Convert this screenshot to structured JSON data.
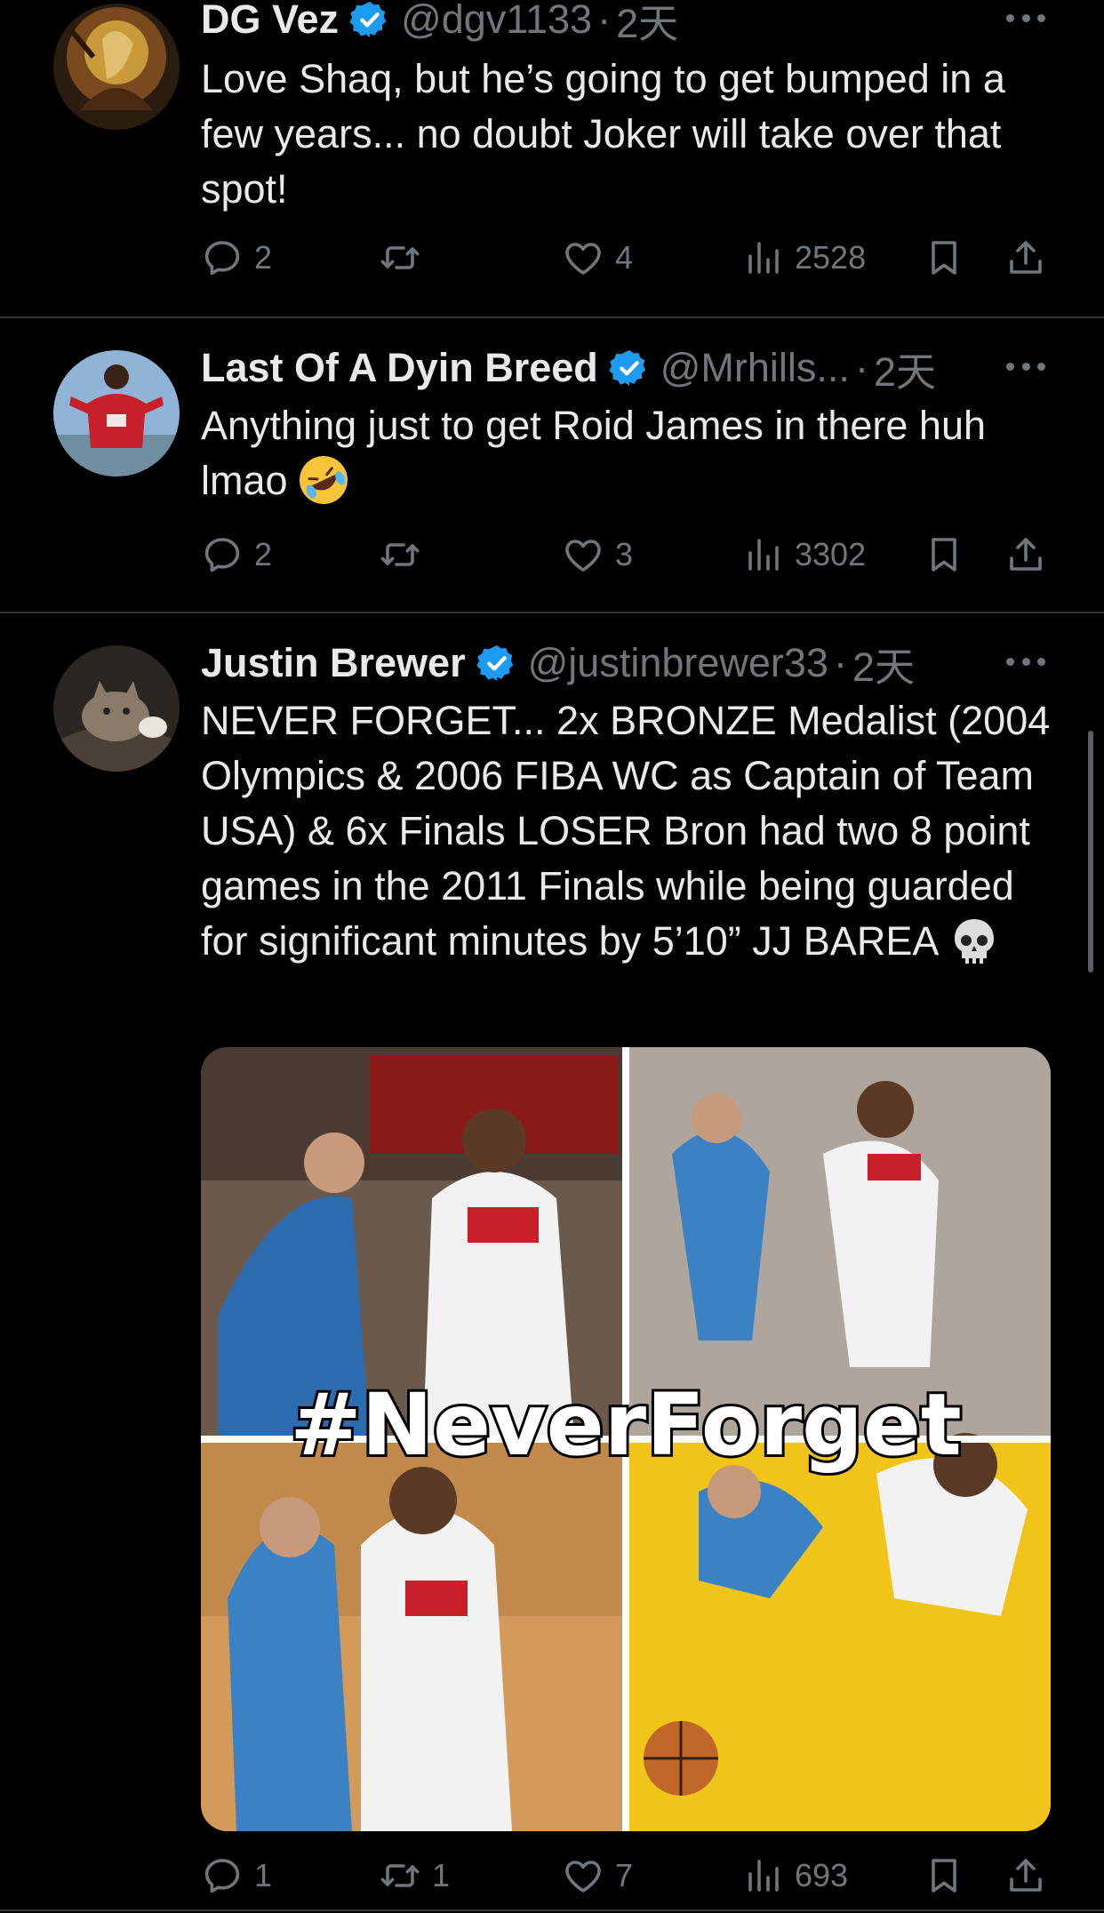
{
  "tweets": [
    {
      "name": "DG Vez",
      "handle": "@dgv1133",
      "time": "2天",
      "text": "Love Shaq, but he’s going to get bumped in a few years... no doubt Joker will take over that spot!",
      "replies": "2",
      "retweets": "",
      "likes": "4",
      "views": "2528"
    },
    {
      "name": "Last Of A Dyin Breed",
      "handle": "@Mrhills...",
      "time": "2天",
      "text": "Anything just to get Roid James in there huh lmao",
      "emoji": "rolling-on-floor-laughing-emoji",
      "replies": "2",
      "retweets": "",
      "likes": "3",
      "views": "3302"
    },
    {
      "name": "Justin Brewer",
      "handle": "@justinbrewer33",
      "time": "2天",
      "text": "NEVER FORGET... 2x BRONZE Medalist (2004 Olympics & 2006 FIBA WC as Captain of Team USA) & 6x Finals LOSER Bron had two 8 point games in the 2011 Finals while being guarded for significant minutes by 5’10” JJ BAREA",
      "emoji": "skull-emoji",
      "image_caption": "#NeverForget",
      "replies": "1",
      "retweets": "1",
      "likes": "7",
      "views": "693"
    }
  ],
  "colors": {
    "background": "#000000",
    "text": "#e7e9ea",
    "muted": "#71767b",
    "verified": "#1d9bf0",
    "divider": "#2f3336"
  },
  "icons": [
    "verified-badge-icon",
    "more-icon",
    "reply-icon",
    "retweet-icon",
    "like-icon",
    "views-icon",
    "bookmark-icon",
    "share-icon"
  ]
}
